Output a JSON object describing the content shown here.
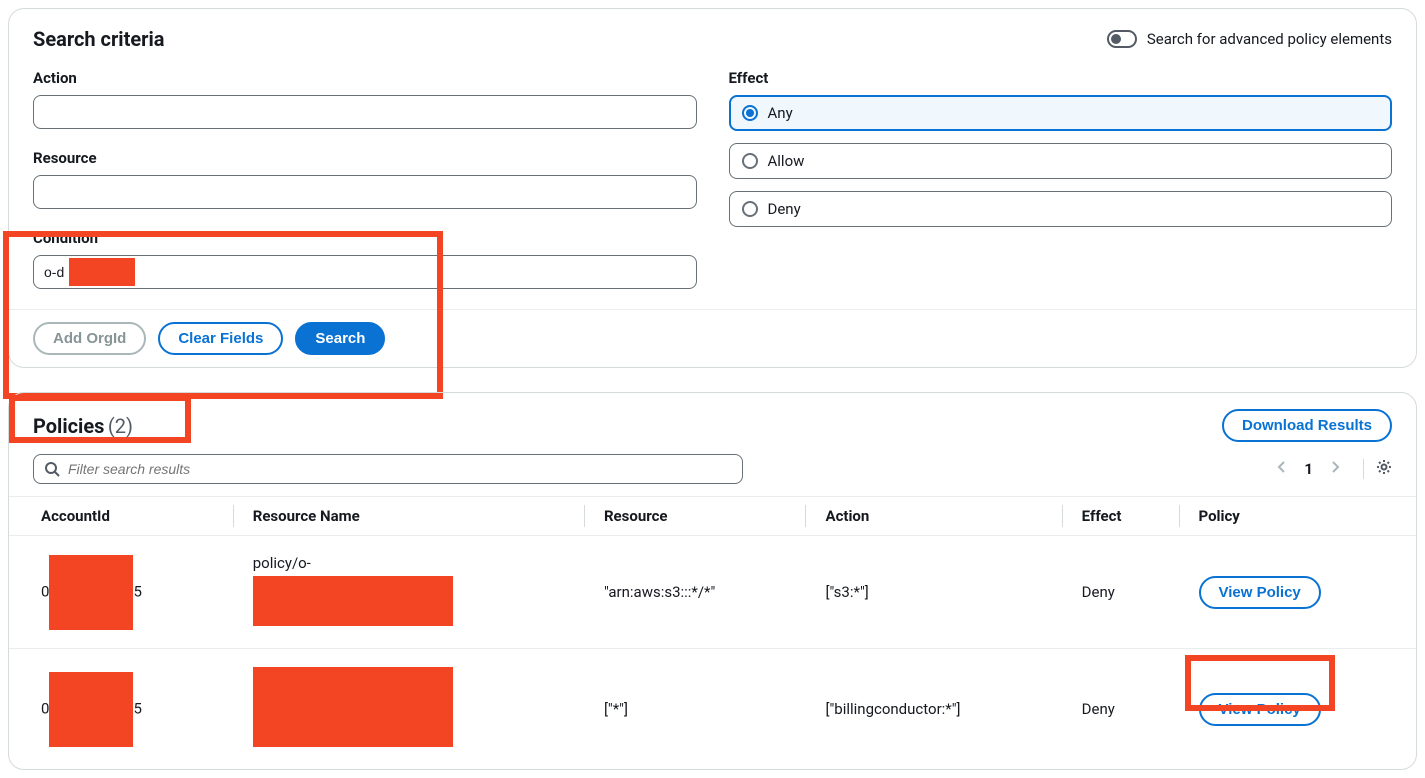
{
  "search_criteria": {
    "title": "Search criteria",
    "advanced_toggle_label": "Search for advanced policy elements",
    "action_label": "Action",
    "action_value": "",
    "resource_label": "Resource",
    "resource_value": "",
    "condition_label": "Condition",
    "condition_value": "o-d            r",
    "effect_label": "Effect",
    "effect_options": {
      "any": "Any",
      "allow": "Allow",
      "deny": "Deny"
    },
    "effect_selected": "Any",
    "buttons": {
      "add_orgid": "Add OrgId",
      "clear_fields": "Clear Fields",
      "search": "Search"
    }
  },
  "results": {
    "title": "Policies",
    "count": "(2)",
    "download_label": "Download Results",
    "filter_placeholder": "Filter search results",
    "page": "1",
    "columns": {
      "account_id": "AccountId",
      "resource_name": "Resource Name",
      "resource": "Resource",
      "action": "Action",
      "effect": "Effect",
      "policy": "Policy"
    },
    "rows": [
      {
        "account_id_prefix": "0",
        "account_id_suffix": "5",
        "resource_name_prefix": "policy/o-",
        "resource": "\"arn:aws:s3:::*/*\"",
        "action": "[\"s3:*\"]",
        "effect": "Deny",
        "policy_btn": "View Policy"
      },
      {
        "account_id_prefix": "0",
        "account_id_suffix": "5",
        "resource_name_prefix": "",
        "resource": "[\"*\"]",
        "action": "[\"billingconductor:*\"]",
        "effect": "Deny",
        "policy_btn": "View Policy"
      }
    ]
  }
}
